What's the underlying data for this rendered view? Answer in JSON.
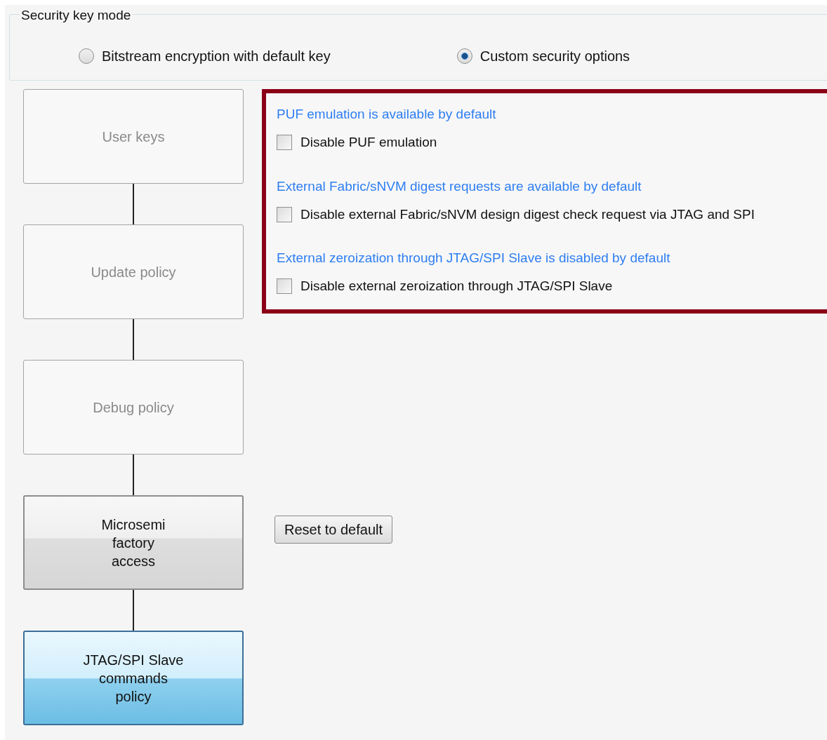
{
  "security_key_mode": {
    "title": "Security key mode",
    "options": [
      {
        "label": "Bitstream encryption with default key",
        "selected": false
      },
      {
        "label": "Custom security options",
        "selected": true
      }
    ]
  },
  "steps": [
    {
      "label": "User keys",
      "disabled": true,
      "selected": false
    },
    {
      "label": "Update policy",
      "disabled": true,
      "selected": false
    },
    {
      "label": "Debug policy",
      "disabled": true,
      "selected": false
    },
    {
      "label": "Microsemi\nfactory\naccess",
      "disabled": false,
      "selected": false
    },
    {
      "label": "JTAG/SPI Slave\ncommands\npolicy",
      "disabled": false,
      "selected": true
    }
  ],
  "options_panel": [
    {
      "note": "PUF emulation is available by default",
      "checkbox": "Disable PUF emulation",
      "checked": false
    },
    {
      "note": "External Fabric/sNVM digest requests are available by default",
      "checkbox": "Disable external Fabric/sNVM design digest check request via JTAG and SPI",
      "checked": false
    },
    {
      "note": "External zeroization through JTAG/SPI Slave is disabled by default",
      "checkbox": "Disable external zeroization through JTAG/SPI Slave",
      "checked": false
    }
  ],
  "reset_button": "Reset to default"
}
